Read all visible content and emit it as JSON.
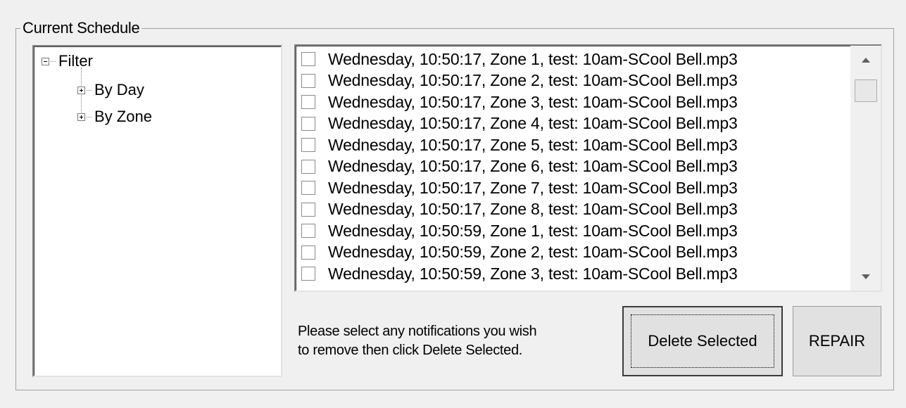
{
  "groupbox": {
    "title": "Current Schedule"
  },
  "tree": {
    "root": {
      "label": "Filter",
      "expanded": true
    },
    "children": [
      {
        "label": "By Day",
        "expanded": false
      },
      {
        "label": "By Zone",
        "expanded": false
      }
    ]
  },
  "list": {
    "items": [
      "Wednesday, 10:50:17, Zone 1, test: 10am-SCool Bell.mp3",
      "Wednesday, 10:50:17, Zone 2, test: 10am-SCool Bell.mp3",
      "Wednesday, 10:50:17, Zone 3, test: 10am-SCool Bell.mp3",
      "Wednesday, 10:50:17, Zone 4, test: 10am-SCool Bell.mp3",
      "Wednesday, 10:50:17, Zone 5, test: 10am-SCool Bell.mp3",
      "Wednesday, 10:50:17, Zone 6, test: 10am-SCool Bell.mp3",
      "Wednesday, 10:50:17, Zone 7, test: 10am-SCool Bell.mp3",
      "Wednesday, 10:50:17, Zone 8, test: 10am-SCool Bell.mp3",
      "Wednesday, 10:50:59, Zone 1, test: 10am-SCool Bell.mp3",
      "Wednesday, 10:50:59, Zone 2, test: 10am-SCool Bell.mp3",
      "Wednesday, 10:50:59, Zone 3, test: 10am-SCool Bell.mp3"
    ]
  },
  "hint": {
    "line1": "Please select any notifications you wish",
    "line2": "to remove then click Delete Selected."
  },
  "buttons": {
    "delete_label": "Delete Selected",
    "repair_label": "REPAIR"
  }
}
